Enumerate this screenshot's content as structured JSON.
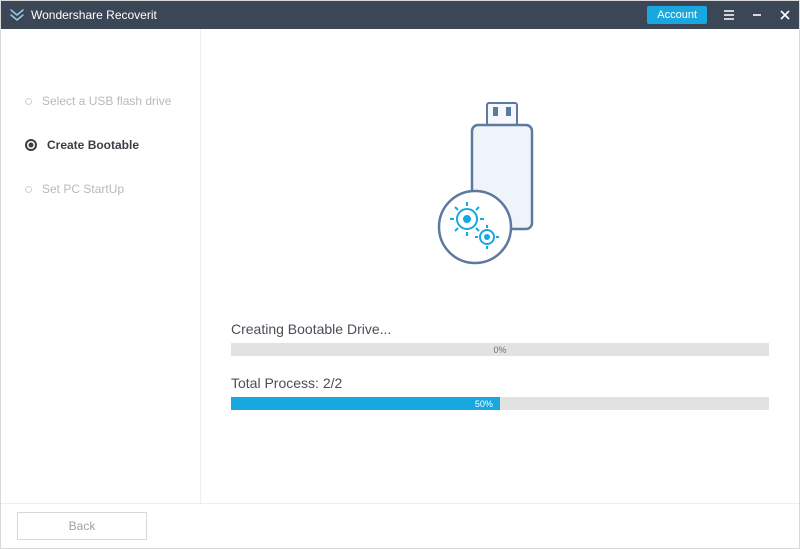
{
  "titlebar": {
    "app_name": "Wondershare Recoverit",
    "account_label": "Account"
  },
  "sidebar": {
    "steps": [
      {
        "label": "Select a USB flash drive",
        "active": false
      },
      {
        "label": "Create Bootable",
        "active": true
      },
      {
        "label": "Set PC StartUp",
        "active": false
      }
    ]
  },
  "main": {
    "progress1": {
      "label": "Creating Bootable Drive...",
      "percent": 0,
      "percent_text": "0%"
    },
    "progress2": {
      "label": "Total Process: 2/2",
      "percent": 50,
      "percent_text": "50%"
    }
  },
  "footer": {
    "back_label": "Back"
  },
  "colors": {
    "accent": "#19a7e0",
    "titlebar_bg": "#3b4657"
  }
}
